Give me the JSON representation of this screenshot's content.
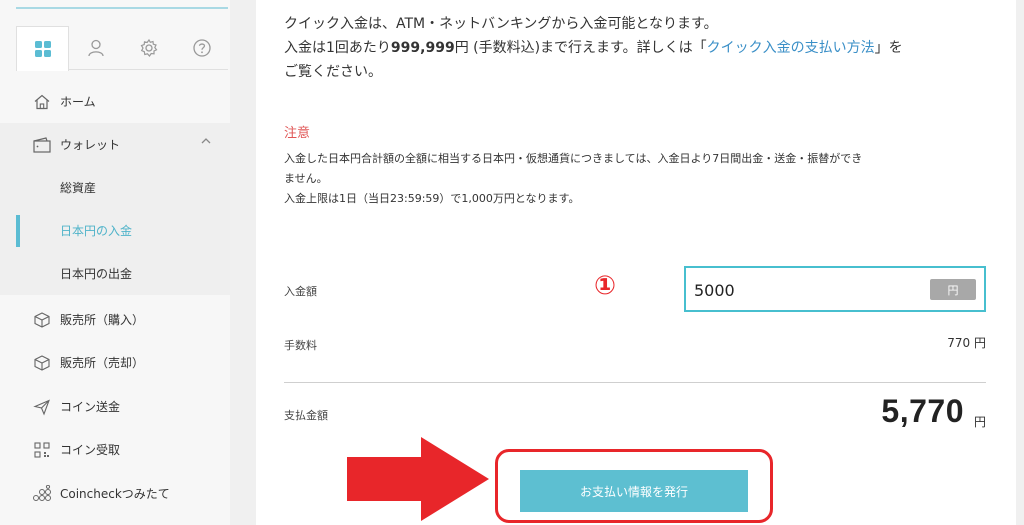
{
  "sidebar": {
    "tabs": [
      {
        "icon": "dashboard-grid-icon"
      },
      {
        "icon": "user-icon"
      },
      {
        "icon": "gear-icon"
      },
      {
        "icon": "help-icon"
      }
    ],
    "items": [
      {
        "label": "ホーム",
        "icon": "home-icon"
      },
      {
        "label": "ウォレット",
        "icon": "wallet-icon"
      },
      {
        "label": "総資産"
      },
      {
        "label": "日本円の入金"
      },
      {
        "label": "日本円の出金"
      },
      {
        "label": "販売所（購入）",
        "icon": "cube-icon"
      },
      {
        "label": "販売所（売却）",
        "icon": "cube-icon"
      },
      {
        "label": "コイン送金",
        "icon": "send-icon"
      },
      {
        "label": "コイン受取",
        "icon": "qr-code-icon"
      },
      {
        "label": "Coincheckつみたて",
        "icon": "coins-icon"
      }
    ],
    "active_color": "#5bbcd3"
  },
  "main": {
    "intro": {
      "line1": "クイック入金は、ATM・ネットバンキングから入金可能となります。",
      "line2_prefix": "入金は1回あたり",
      "line2_amount": "999,999",
      "line2_mid": "円 (手数料込)まで行えます。詳しくは「",
      "line2_link": "クイック入金の支払い方法",
      "line2_suffix": "」を",
      "line3": "ご覧ください。"
    },
    "notice": {
      "title": "注意",
      "line1": "入金した日本円合計額の全額に相当する日本円・仮想通貨につきましては、入金日より7日間出金・送金・振替ができ",
      "line2": "ません。",
      "line3": "入金上限は1日（当日23:59:59）で1,000万円となります。"
    },
    "amount": {
      "label": "入金額",
      "value": "5000",
      "unit": "円",
      "step_marker": "①"
    },
    "fee": {
      "label": "手数料",
      "value": "770 円"
    },
    "total": {
      "label": "支払金額",
      "value": "5,770",
      "unit": "円"
    },
    "issue_button": "お支払い情報を発行",
    "accent_color": "#e8262a"
  }
}
